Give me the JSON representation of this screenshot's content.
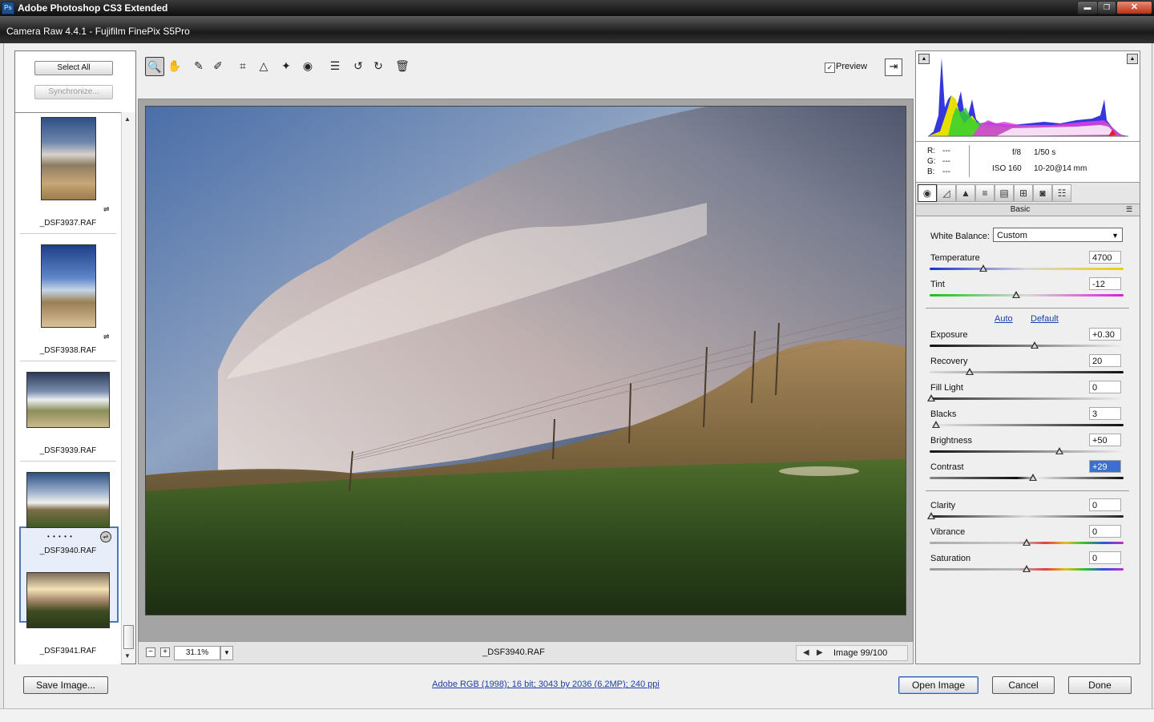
{
  "app": {
    "title": "Adobe Photoshop CS3 Extended",
    "icon": "Ps"
  },
  "dialog": {
    "title": "Camera Raw 4.4.1  -  Fujifilm FinePix S5Pro"
  },
  "window_controls": {
    "minimize": "▬",
    "maximize": "❐",
    "close": "✕"
  },
  "filmstrip": {
    "select_all": "Select All",
    "synchronize": "Synchronize...",
    "items": [
      {
        "filename": "_DSF3937.RAF",
        "selected": false
      },
      {
        "filename": "_DSF3938.RAF",
        "selected": false
      },
      {
        "filename": "_DSF3939.RAF",
        "selected": false
      },
      {
        "filename": "_DSF3940.RAF",
        "selected": true,
        "rating_dots": "• • • • •"
      },
      {
        "filename": "_DSF3941.RAF",
        "selected": false
      }
    ]
  },
  "toolbar": {
    "tools": [
      "zoom-icon",
      "hand-icon",
      "white-balance-icon",
      "color-sampler-icon",
      "crop-icon",
      "straighten-icon",
      "retouch-icon",
      "red-eye-icon",
      "preferences-icon",
      "rotate-left-icon",
      "rotate-right-icon",
      "trash-icon"
    ],
    "preview_label": "Preview",
    "preview_checked": true
  },
  "preview": {
    "zoom_level": "31.1%",
    "filename": "_DSF3940.RAF",
    "image_counter": "Image 99/100"
  },
  "exif": {
    "r_label": "R:",
    "r_value": "---",
    "g_label": "G:",
    "g_value": "---",
    "b_label": "B:",
    "b_value": "---",
    "aperture": "f/8",
    "shutter": "1/50 s",
    "iso": "ISO 160",
    "lens": "10-20@14 mm"
  },
  "panel": {
    "title": "Basic",
    "white_balance_label": "White Balance:",
    "white_balance_value": "Custom",
    "auto": "Auto",
    "default": "Default",
    "temperature": {
      "label": "Temperature",
      "value": "4700",
      "position": 0.27
    },
    "tint": {
      "label": "Tint",
      "value": "-12",
      "position": 0.45
    },
    "exposure": {
      "label": "Exposure",
      "value": "+0.30",
      "position": 0.53
    },
    "recovery": {
      "label": "Recovery",
      "value": "20",
      "position": 0.2
    },
    "fill_light": {
      "label": "Fill Light",
      "value": "0",
      "position": 0.0
    },
    "blacks": {
      "label": "Blacks",
      "value": "3",
      "position": 0.03
    },
    "brightness": {
      "label": "Brightness",
      "value": "+50",
      "position": 0.66
    },
    "contrast": {
      "label": "Contrast",
      "value": "+29",
      "position": 0.53
    },
    "clarity": {
      "label": "Clarity",
      "value": "0",
      "position": 0.0
    },
    "vibrance": {
      "label": "Vibrance",
      "value": "0",
      "position": 0.5
    },
    "saturation": {
      "label": "Saturation",
      "value": "0",
      "position": 0.5
    }
  },
  "bottom": {
    "save_image": "Save Image...",
    "workflow": "Adobe RGB (1998); 16 bit; 3043 by 2036 (6.2MP); 240 ppi",
    "open_image": "Open Image",
    "cancel": "Cancel",
    "done": "Done"
  }
}
